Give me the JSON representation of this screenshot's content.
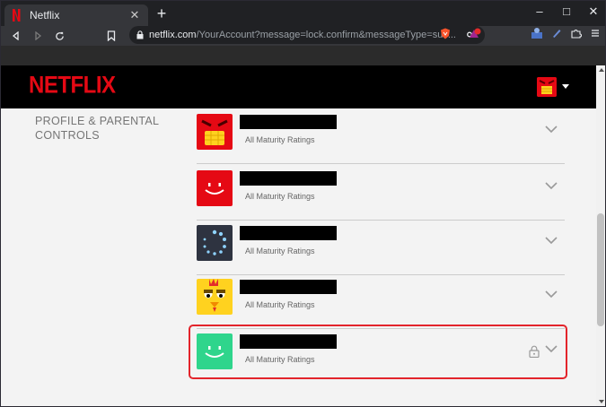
{
  "browser": {
    "tab_title": "Netflix",
    "tab_close": "✕",
    "new_tab": "+",
    "window_controls": {
      "minimize": "–",
      "maximize": "□",
      "close": "✕"
    },
    "url_host": "netflix.com",
    "url_path": "/YourAccount?message=lock.confirm&messageType=suc..."
  },
  "netflix": {
    "logo": "NETFLIX",
    "brand_color": "#e50914"
  },
  "section": {
    "title": "PROFILE & PARENTAL CONTROLS"
  },
  "profiles": [
    {
      "avatar": "red-grin-avatar",
      "rating": "All Maturity Ratings",
      "locked": false
    },
    {
      "avatar": "red-smile-avatar",
      "rating": "All Maturity Ratings",
      "locked": false
    },
    {
      "avatar": "dark-spinner-avatar",
      "rating": "All Maturity Ratings",
      "locked": false
    },
    {
      "avatar": "yellow-chicken-avatar",
      "rating": "All Maturity Ratings",
      "locked": false
    },
    {
      "avatar": "green-smile-avatar",
      "rating": "All Maturity Ratings",
      "locked": true
    }
  ]
}
